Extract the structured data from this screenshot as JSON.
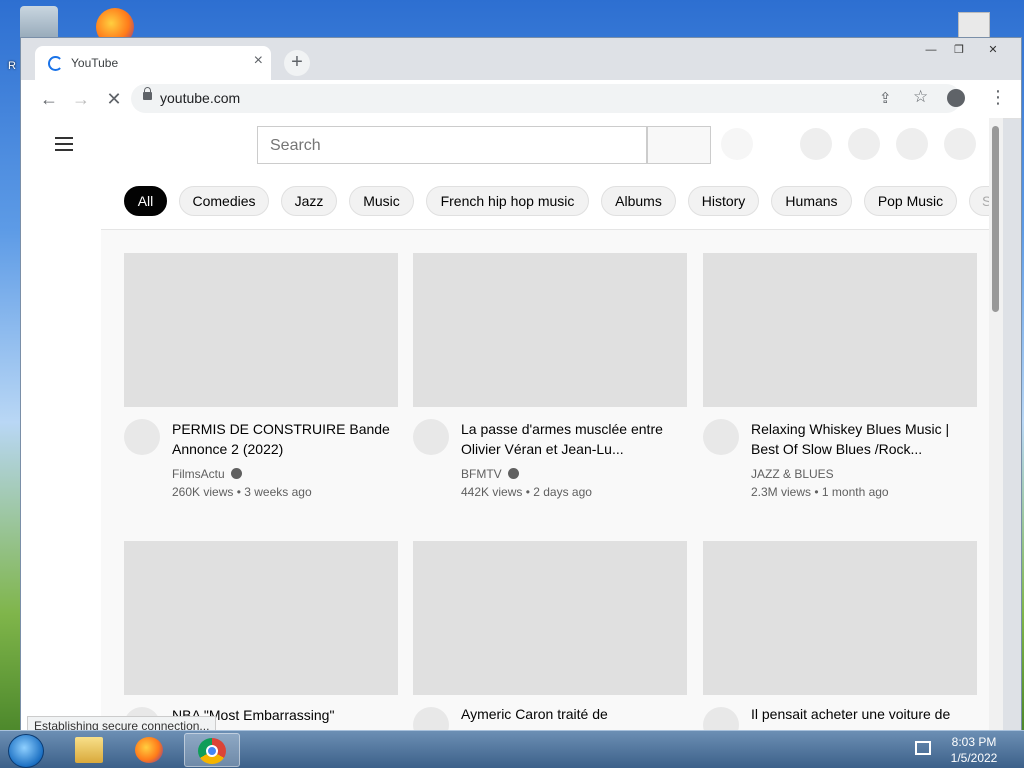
{
  "desktop": {
    "recycle_bin_label": "R",
    "right_icon_label": ""
  },
  "browser": {
    "tab_title": "YouTube",
    "tab_close": "×",
    "new_tab": "+",
    "window_controls": {
      "minimize": "—",
      "restore": "❐",
      "close": "✕"
    },
    "nav": {
      "back": "←",
      "forward": "→",
      "stop": "✕"
    },
    "url": "youtube.com",
    "share_icon": "⇪",
    "star_icon": "☆",
    "menu_icon": "⋮",
    "status_text": "Establishing secure connection..."
  },
  "youtube": {
    "search_placeholder": "Search",
    "chips": [
      "All",
      "Comedies",
      "Jazz",
      "Music",
      "French hip hop music",
      "Albums",
      "History",
      "Humans",
      "Pop Music",
      "Sc"
    ],
    "videos": [
      {
        "title": "PERMIS DE CONSTRUIRE Bande Annonce 2 (2022)",
        "channel": "FilmsActu",
        "verified": true,
        "meta": "260K views • 3 weeks ago"
      },
      {
        "title": "La passe d'armes musclée entre Olivier Véran et Jean-Lu...",
        "channel": "BFMTV",
        "verified": true,
        "meta": "442K views • 2 days ago"
      },
      {
        "title": "Relaxing Whiskey Blues Music | Best Of Slow Blues /Rock...",
        "channel": "JAZZ & BLUES",
        "verified": false,
        "meta": "2.3M views • 1 month ago"
      },
      {
        "title": "NBA \"Most Embarrassing\"",
        "channel": "",
        "verified": false,
        "meta": ""
      },
      {
        "title": "Aymeric Caron traité de",
        "channel": "",
        "verified": false,
        "meta": ""
      },
      {
        "title": "Il pensait acheter une voiture de",
        "channel": "",
        "verified": false,
        "meta": ""
      }
    ]
  },
  "taskbar": {
    "time": "8:03 PM",
    "date": "1/5/2022"
  },
  "colors": {
    "chip_active": "#030303",
    "thumb_placeholder": "#e0e0e0",
    "accent_blue": "#1a73e8"
  }
}
